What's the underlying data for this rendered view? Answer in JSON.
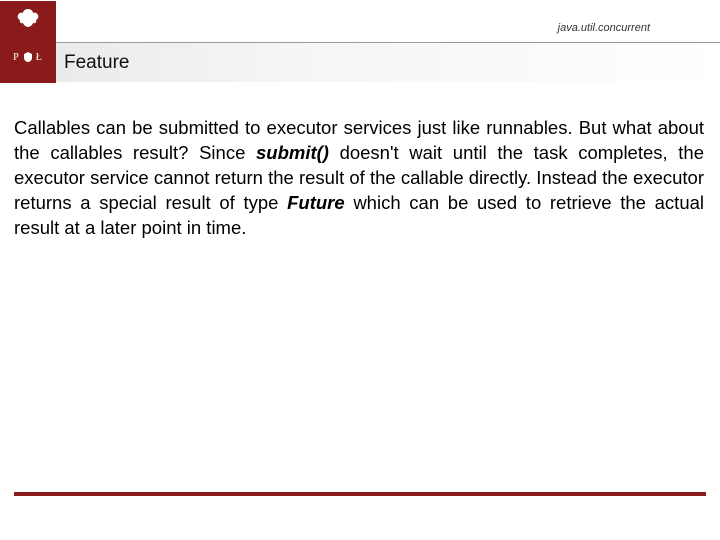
{
  "header": {
    "package": "java.util.concurrent",
    "title": "Feature",
    "logo": {
      "left_letter": "P",
      "right_letter": "Ł"
    }
  },
  "body": {
    "p1_a": "Callables can be submitted to executor services just like runnables. But what about the callables result? Since ",
    "p1_submit": "submit()",
    "p1_b": " doesn't wait until the task completes, the executor service cannot return the result of the callable directly. Instead the executor returns a special result of type ",
    "p1_future": "Future",
    "p1_c": " which can be used to retrieve the actual result at a later point in time."
  },
  "colors": {
    "brand": "#8b1a1a"
  }
}
